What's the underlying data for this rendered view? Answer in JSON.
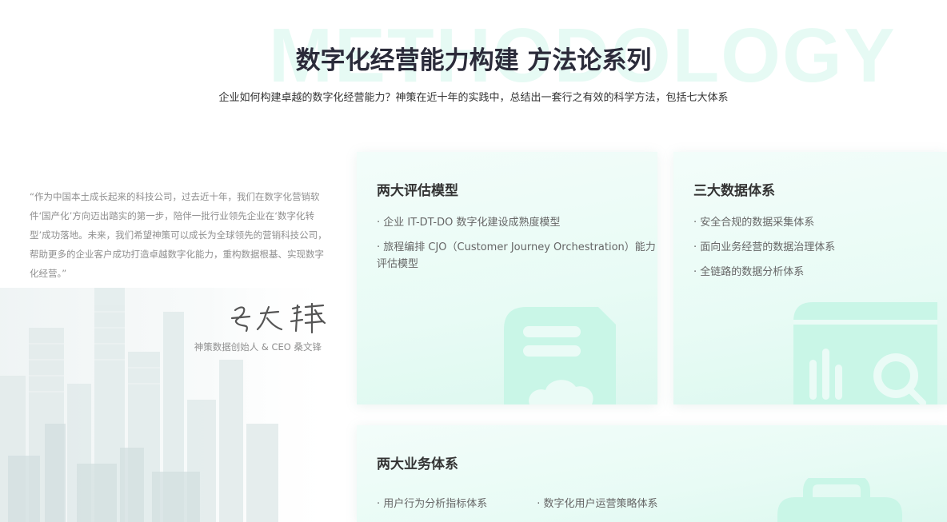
{
  "header": {
    "watermark": "METHODOLOGY",
    "title": "数字化经营能力构建 方法论系列",
    "subtitle": "企业如何构建卓越的数字化经营能力？神策在近十年的实践中，总结出一套行之有效的科学方法，包括七大体系"
  },
  "quote": {
    "text": "“作为中国本土成长起来的科技公司，过去近十年，我们在数字化营销软件‘国产化’方向迈出踏实的第一步，陪伴一批行业领先企业在‘数字化转型’成功落地。未来，我们希望神策可以成长为全球领先的营销科技公司，帮助更多的企业客户成功打造卓越数字化能力，重构数据根基、实现数字化经营。”",
    "attribution": "神策数据创始人 & CEO 桑文锋"
  },
  "cards": [
    {
      "title": "两大评估模型",
      "items": [
        "企业 IT-DT-DO 数字化建设成熟度模型",
        "旅程编排 CJO（Customer Journey Orchestration）能力评估模型"
      ],
      "icon": "document-cloud-icon"
    },
    {
      "title": "三大数据体系",
      "items": [
        "安全合规的数据采集体系",
        "面向业务经营的数据治理体系",
        "全链路的数据分析体系"
      ],
      "icon": "chart-search-icon"
    },
    {
      "title": "两大业务体系",
      "items": [
        "用户行为分析指标体系",
        "数字化用户运营策略体系"
      ],
      "icon": "briefcase-icon"
    }
  ],
  "colors": {
    "accent": "#c9f6e7",
    "card_bg": "#eafbf6",
    "title_text": "#2b2b3a",
    "muted_text": "#8f8f8f"
  }
}
